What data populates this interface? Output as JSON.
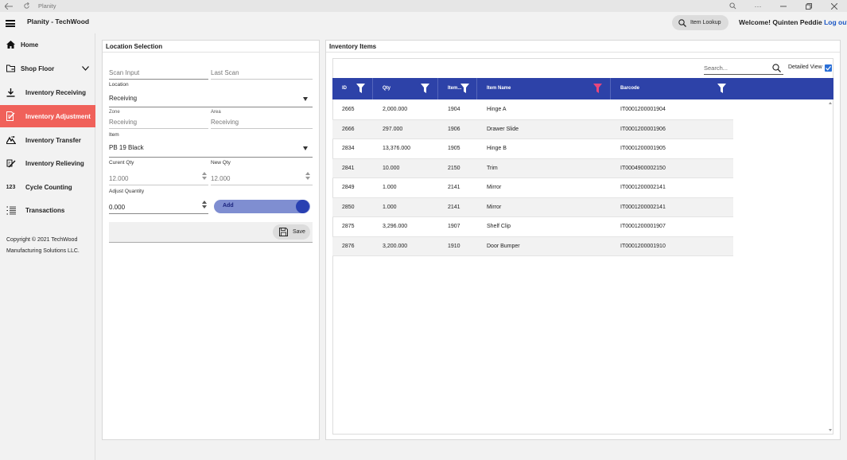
{
  "window": {
    "title": "Planity"
  },
  "header": {
    "app_title": "Planity - TechWood",
    "lookup_label": "Item Lookup",
    "welcome": "Welcome! Quinten Peddie",
    "logout_label": "Log out"
  },
  "sidebar": {
    "items": [
      {
        "label": "Home",
        "icon": "home-icon"
      },
      {
        "label": "Shop Floor",
        "icon": "shop-floor-icon"
      },
      {
        "label": "Inventory Receiving",
        "icon": "download-icon"
      },
      {
        "label": "Inventory Adjustment",
        "icon": "edit-document-icon"
      },
      {
        "label": "Inventory Transfer",
        "icon": "transfer-icon"
      },
      {
        "label": "Inventory Relieving",
        "icon": "relieving-icon"
      },
      {
        "label": "Cycle Counting",
        "icon": "123"
      },
      {
        "label": "Transactions",
        "icon": "list-icon"
      }
    ],
    "copyright_line1": "Copyright © 2021 TechWood",
    "copyright_line2": "Manufacturing Solutions LLC."
  },
  "location": {
    "title": "Location Selection",
    "scan_input_placeholder": "Scan Input",
    "last_scan_placeholder": "Last Scan",
    "location_label": "Location",
    "location_value": "Receiving",
    "zone_label": "Zone",
    "zone_value": "Receiving",
    "area_label": "Area",
    "area_value": "Receiving",
    "item_label": "Item",
    "item_value": "PB 19 Black",
    "current_qty_label": "Curent Qty",
    "current_qty_value": "12.000",
    "new_qty_label": "New Qty",
    "new_qty_value": "12.000",
    "adjust_label": "Adjust Quantity",
    "adjust_value": "0.000",
    "toggle_label": "Add",
    "save_label": "Save"
  },
  "inventory": {
    "title": "Inventory Items",
    "search_placeholder": "Search...",
    "detailed_view_label": "Detailed View",
    "detailed_view_checked": true,
    "columns": [
      "ID",
      "Qty",
      "Item...",
      "Item Name",
      "Barcode"
    ],
    "rows": [
      [
        "2665",
        "2,000.000",
        "1904",
        "Hinge A",
        "IT0001200001904"
      ],
      [
        "2666",
        "297.000",
        "1906",
        "Drawer Slide",
        "IT0001200001906"
      ],
      [
        "2834",
        "13,376.000",
        "1905",
        "Hinge B",
        "IT0001200001905"
      ],
      [
        "2841",
        "10.000",
        "2150",
        "Trim",
        "IT0004900002150"
      ],
      [
        "2849",
        "1.000",
        "2141",
        "Mirror",
        "IT0001200002141"
      ],
      [
        "2850",
        "1.000",
        "2141",
        "Mirror",
        "IT0001200002141"
      ],
      [
        "2875",
        "3,296.000",
        "1907",
        "Shelf Clip",
        "IT0001200001907"
      ],
      [
        "2876",
        "3,200.000",
        "1910",
        "Door Bumper",
        "IT0001200001910"
      ]
    ]
  },
  "colors": {
    "active_nav": "#f0615a",
    "grid_header": "#2d42a8",
    "active_filter": "#e8467c",
    "link": "#1a56c4"
  }
}
